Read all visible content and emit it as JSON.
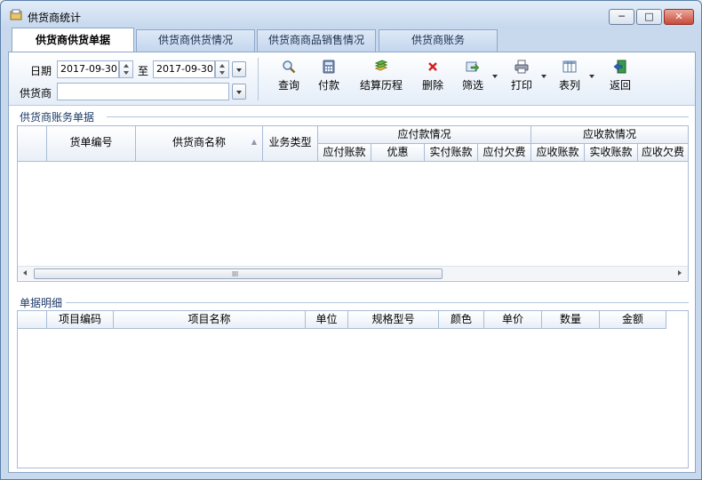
{
  "window": {
    "title": "供货商统计",
    "min": "─",
    "max": "□",
    "close": "✕"
  },
  "tabs": [
    "供货商供货单据",
    "供货商供货情况",
    "供货商商品销售情况",
    "供货商账务"
  ],
  "filters": {
    "date_label": "日期",
    "date_from": "2017-09-30",
    "to_label": "至",
    "date_to": "2017-09-30",
    "supplier_label": "供货商",
    "supplier_value": ""
  },
  "toolbar": {
    "query": "查询",
    "pay": "付款",
    "history": "结算历程",
    "delete": "删除",
    "filter": "筛选",
    "print": "打印",
    "columns": "表列",
    "back": "返回"
  },
  "section1": {
    "title": "供货商账务单据",
    "headers": {
      "doc_no": "货单编号",
      "supplier_name": "供货商名称",
      "biz_type": "业务类型",
      "payable_group": "应付款情况",
      "payable_amount": "应付账款",
      "discount": "优惠",
      "paid_amount": "实付账款",
      "payable_owed": "应付欠费",
      "receivable_group": "应收款情况",
      "receivable_amount": "应收账款",
      "received_amount": "实收账款",
      "receivable_owed": "应收欠费"
    },
    "scroll_grip": "III"
  },
  "section2": {
    "title": "单据明细",
    "headers": {
      "item_code": "项目编码",
      "item_name": "项目名称",
      "unit": "单位",
      "spec": "规格型号",
      "color": "颜色",
      "price": "单价",
      "qty": "数量",
      "amount": "金额"
    }
  }
}
